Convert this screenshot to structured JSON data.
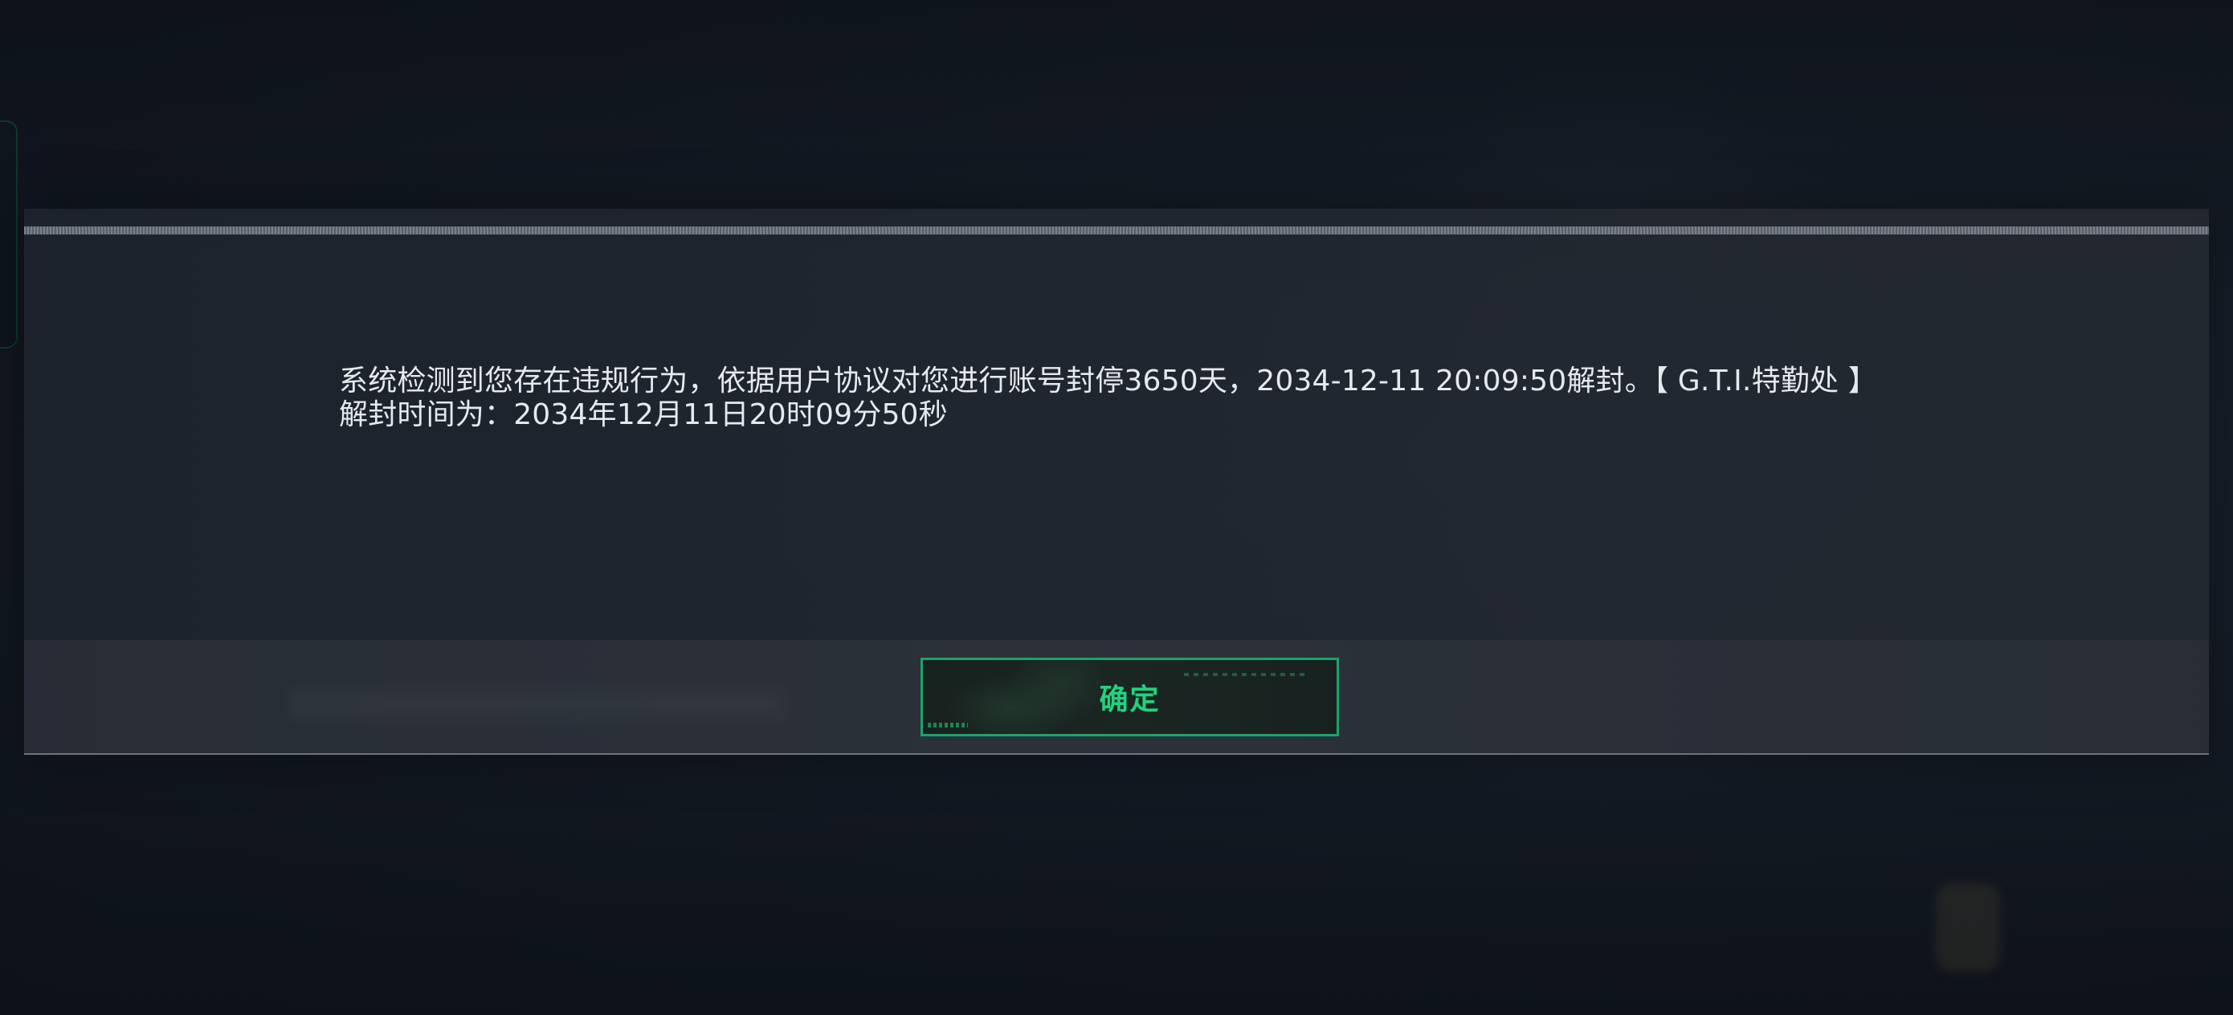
{
  "dialog": {
    "message_line1": "系统检测到您存在违规行为，依据用户协议对您进行账号封停3650天，2034-12-11 20:09:50解封。【 G.T.I.特勤处 】",
    "message_line2": "解封时间为：2034年12月11日20时09分50秒"
  },
  "footer": {
    "confirm_label": "确定"
  },
  "colors": {
    "accent": "#22d27e",
    "button_border": "#1aa46a",
    "text": "#e6e9ee",
    "panel": "#212731"
  }
}
